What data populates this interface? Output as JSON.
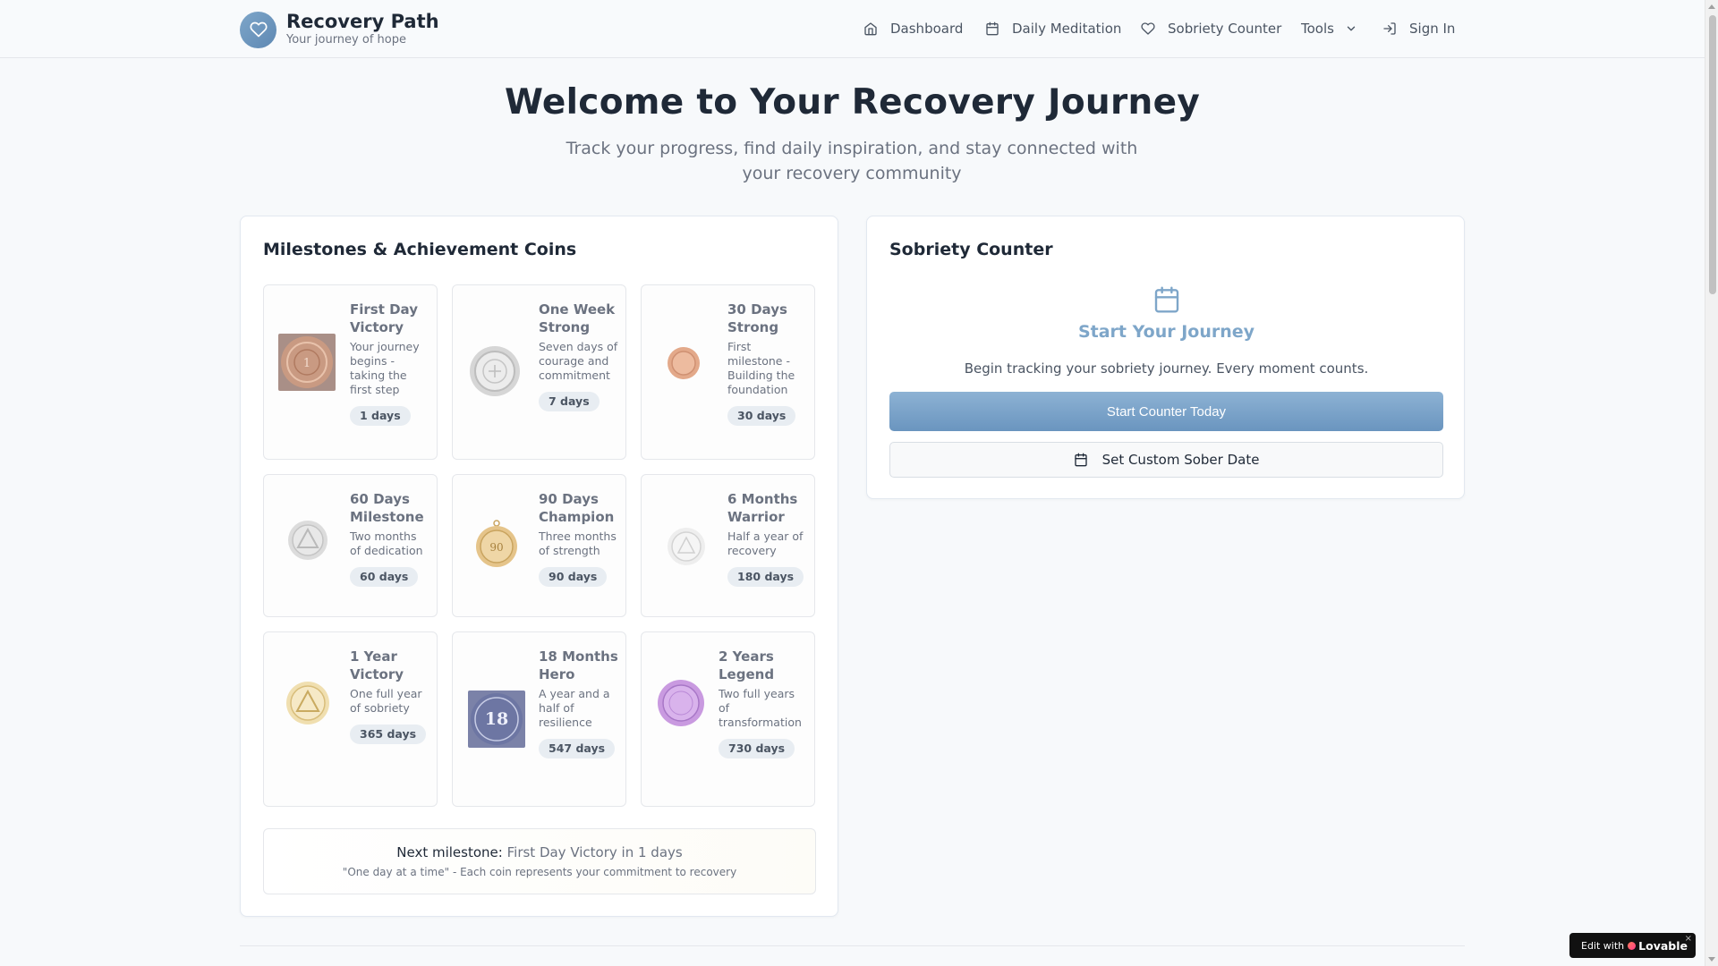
{
  "brand": {
    "title": "Recovery Path",
    "subtitle": "Your journey of hope"
  },
  "nav": {
    "dashboard": "Dashboard",
    "meditation": "Daily Meditation",
    "counter": "Sobriety Counter",
    "tools": "Tools",
    "signin": "Sign In"
  },
  "hero": {
    "title": "Welcome to Your Recovery Journey",
    "subtitle": "Track your progress, find daily inspiration, and stay connected with your recovery community"
  },
  "milestones": {
    "title": "Milestones & Achievement Coins",
    "coins": [
      {
        "name": "First Day Victory",
        "desc": "Your journey begins - taking the first step",
        "days": "1 days",
        "icon": "bronze-coin"
      },
      {
        "name": "One Week Strong",
        "desc": "Seven days of courage and commitment",
        "days": "7 days",
        "icon": "silver-coin"
      },
      {
        "name": "30 Days Strong",
        "desc": "First milestone - Building the foundation",
        "days": "30 days",
        "icon": "copper-coin"
      },
      {
        "name": "60 Days Milestone",
        "desc": "Two months of dedication",
        "days": "60 days",
        "icon": "silver-triangle-coin"
      },
      {
        "name": "90 Days Champion",
        "desc": "Three months of strength",
        "days": "90 days",
        "icon": "gold-medal-coin"
      },
      {
        "name": "6 Months Warrior",
        "desc": "Half a year of recovery",
        "days": "180 days",
        "icon": "pale-silver-coin"
      },
      {
        "name": "1 Year Victory",
        "desc": "One full year of sobriety",
        "days": "365 days",
        "icon": "gold-triangle-coin"
      },
      {
        "name": "18 Months Hero",
        "desc": "A year and a half of resilience",
        "days": "547 days",
        "icon": "blue-18-months-coin"
      },
      {
        "name": "2 Years Legend",
        "desc": "Two full years of transformation",
        "days": "730 days",
        "icon": "purple-coin"
      }
    ],
    "next_label": "Next milestone:",
    "next_value": "First Day Victory in 1 days",
    "quote": "\"One day at a time\" - Each coin represents your commitment to recovery"
  },
  "counter": {
    "title": "Sobriety Counter",
    "heading": "Start Your Journey",
    "desc": "Begin tracking your sobriety journey. Every moment counts.",
    "primary_button": "Start Counter Today",
    "secondary_button": "Set Custom Sober Date"
  },
  "badge": {
    "prefix": "Edit with",
    "brand": "Lovable",
    "close": "×"
  },
  "colors": {
    "accent": "#7ea6c9",
    "primary_button": "#7aa3cb",
    "text": "#1f2937",
    "muted": "#6b7280"
  }
}
